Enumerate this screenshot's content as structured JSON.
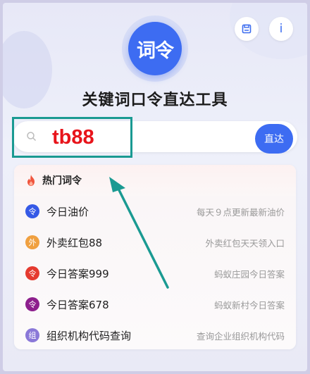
{
  "header": {
    "logo_text": "词令",
    "title": "关键词口令直达工具",
    "save_icon": "save-icon",
    "info_label": "i"
  },
  "search": {
    "value": "tb88",
    "button_label": "直达"
  },
  "hot_list": {
    "header_label": "热门词令",
    "items": [
      {
        "badge": "令",
        "badge_color": "#3559e6",
        "title": "今日油价",
        "desc": "每天９点更新最新油价"
      },
      {
        "badge": "外",
        "badge_color": "#f0a040",
        "title": "外卖红包88",
        "desc": "外卖红包天天领入口"
      },
      {
        "badge": "令",
        "badge_color": "#e53a2f",
        "title": "今日答案999",
        "desc": "蚂蚁庄园今日答案"
      },
      {
        "badge": "令",
        "badge_color": "#8d1f8d",
        "title": "今日答案678",
        "desc": "蚂蚁新村今日答案"
      },
      {
        "badge": "组",
        "badge_color": "#8a78d8",
        "title": "组织机构代码查询",
        "desc": "查询企业组织机构代码"
      }
    ]
  },
  "colors": {
    "accent": "#3d6cf2",
    "highlight": "#1a9a92",
    "search_value": "#e8141b"
  }
}
